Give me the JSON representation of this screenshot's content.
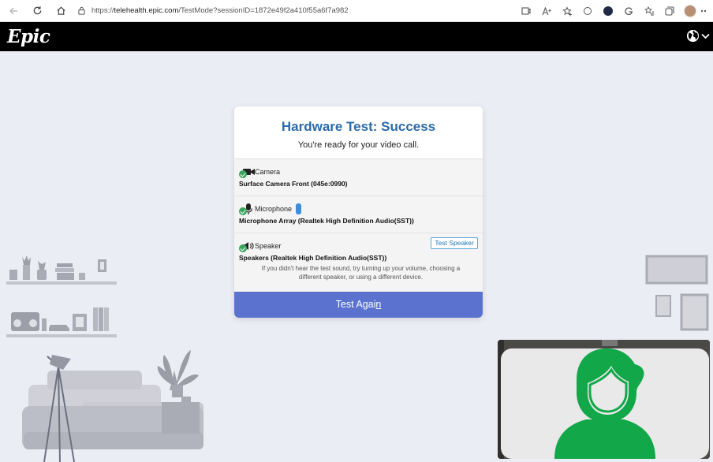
{
  "browser": {
    "url_prefix": "https://",
    "url_host": "telehealth.epic.com",
    "url_path": "/TestMode?sessionID=1872e49f2a410f55a6f7a982"
  },
  "header": {
    "logo": "Epic"
  },
  "card": {
    "title": "Hardware Test: Success",
    "subtitle": "You're ready for your video call.",
    "camera": {
      "label": "Camera",
      "device": "Surface Camera Front (045e:0990)"
    },
    "microphone": {
      "label": "Microphone",
      "device": "Microphone Array (Realtek High Definition Audio(SST))"
    },
    "speaker": {
      "label": "Speaker",
      "device": "Speakers (Realtek High Definition Audio(SST))",
      "test_button": "Test Speaker",
      "help_line1": "If you didn't hear the test sound, try turning up your volume, choosing a",
      "help_line2": "different speaker, or using a different device."
    },
    "test_again_main": "Test Agai",
    "test_again_accel": "n"
  },
  "colors": {
    "title_blue": "#2c6aa8",
    "button_blue": "#5b73cf",
    "success_green": "#3aa55d",
    "avatar_green": "#12a84a",
    "background": "#ebedf5"
  },
  "icons": [
    "back-icon",
    "refresh-icon",
    "home-icon",
    "lock-icon",
    "globe-icon",
    "chevron-down-icon",
    "camera-icon",
    "microphone-icon",
    "speaker-icon",
    "check-icon"
  ]
}
